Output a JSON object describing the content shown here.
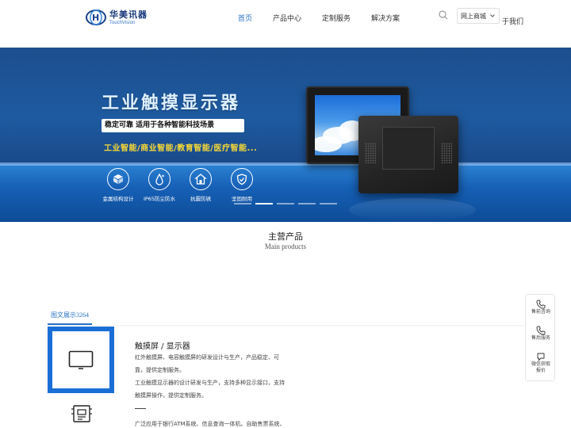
{
  "header": {
    "logo_cn": "华美讯器",
    "logo_en": "TouchVision",
    "nav": [
      "首页",
      "产品中心",
      "定制服务",
      "解决方案"
    ],
    "mall": "网上商城",
    "about": "于我们"
  },
  "banner": {
    "title": "工业触摸显示器",
    "subtitle": "稳定可靠  适用于各种智能科技场景",
    "tags": "工业智能/商业智能/教育智能/医疗智能...",
    "features": [
      "金属结构设计",
      "IP65防尘防水",
      "抗震防锈",
      "坚固耐用"
    ],
    "slides": 5,
    "active_slide": 1
  },
  "products": {
    "title": "主营产品",
    "subtitle": "Main products",
    "tab": "图文展示3264",
    "item_title": "触摸屏 / 显示器",
    "desc1": "红外触摸屏、电容触摸屏的研发设计与生产，产品稳定、可",
    "desc2": "靠，提供定制服务。",
    "desc3": "工业触摸显示器的设计研发与生产，支持多种显示接口，支持",
    "desc4": "触摸屏操作，提供定制服务。",
    "desc5": "广泛应用于银行ATM系统、信息查询一体机、自助售票系统、"
  },
  "side": {
    "presale": "售前咨询",
    "aftersale": "售后服务",
    "wechat1": "微信获取",
    "wechat2": "报价"
  },
  "colors": {
    "accent": "#2a73c8",
    "brand_blue": "#1a6fd6",
    "tag_yellow": "#f6d836"
  }
}
